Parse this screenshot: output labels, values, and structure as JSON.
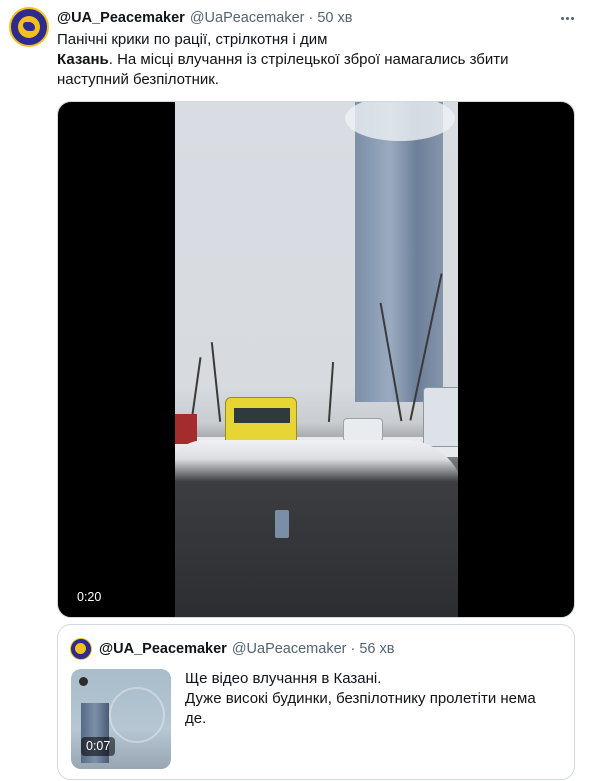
{
  "tweet": {
    "author_name": "@UA_Peacemaker",
    "author_handle": "@UaPeacemaker",
    "separator": "·",
    "time": "50 хв",
    "more_icon": "more-horizontal-icon",
    "text_line1": "Панічні крики по рації, стрілкотня і дим",
    "text_bold": "Казань",
    "text_line2_rest": ". На місці влучання із стрілецької зброї намагались збити",
    "text_line3": "наступний безпілотник.",
    "video": {
      "duration": "0:20"
    }
  },
  "quoted_tweet": {
    "author_name": "@UA_Peacemaker",
    "author_handle": "@UaPeacemaker",
    "separator": "·",
    "time": "56 хв",
    "text_line1": "Ще відео влучання в Казані.",
    "text_line2": "Дуже високі будинки, безпілотнику пролетіти нема",
    "text_line3": "де.",
    "video": {
      "duration": "0:07"
    }
  },
  "colors": {
    "text_primary": "#0f1419",
    "text_secondary": "#536471",
    "border": "#cfd9de",
    "avatar_blue": "#2e2a8f",
    "avatar_yellow": "#f2c21b"
  }
}
